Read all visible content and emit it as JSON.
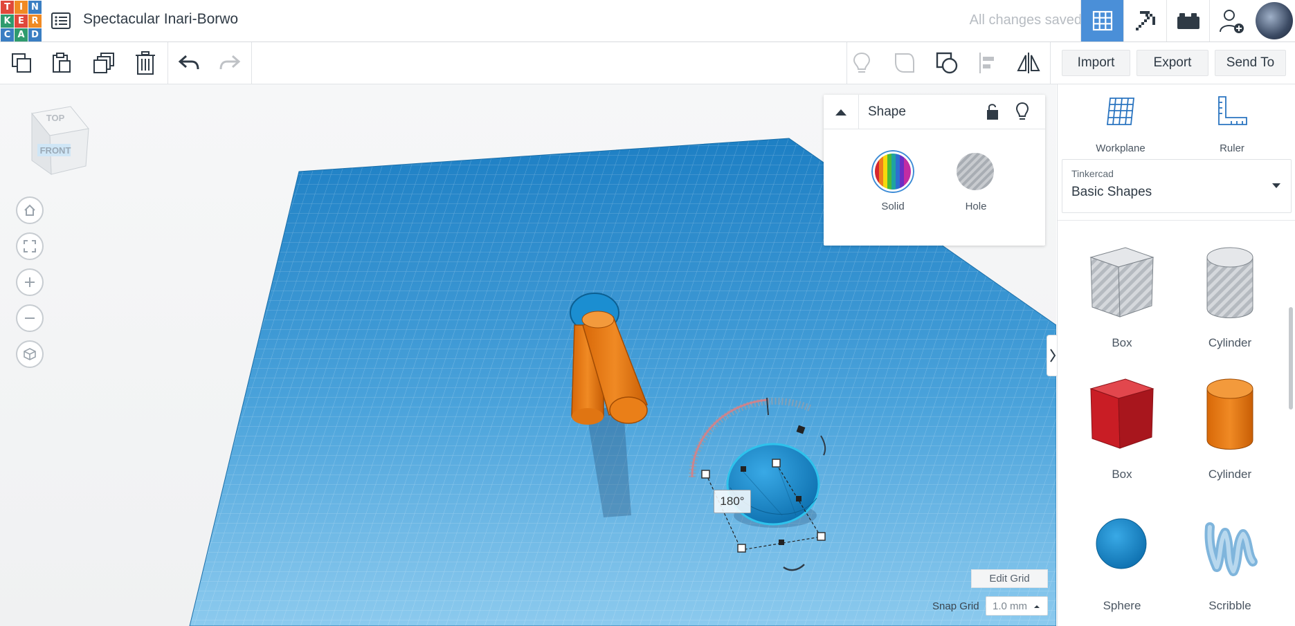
{
  "app": {
    "logo_letters": [
      "T",
      "I",
      "N",
      "K",
      "E",
      "R",
      "C",
      "A",
      "D"
    ],
    "logo_colors": [
      "#e0483b",
      "#f08a24",
      "#3a7ec2",
      "#2f9b6e",
      "#e0483b",
      "#f08a24",
      "#3a7ec2",
      "#2f9b6e",
      "#3a7ec2"
    ],
    "design_title": "Spectacular Inari-Borwo",
    "save_status": "All changes saved"
  },
  "topbar": {
    "buttons": [
      {
        "name": "3d-view",
        "icon": "grid-icon",
        "active": true
      },
      {
        "name": "codeblocks",
        "icon": "pickaxe-icon",
        "active": false
      },
      {
        "name": "bricks",
        "icon": "lego-brick-icon",
        "active": false
      },
      {
        "name": "add-user",
        "icon": "add-user-icon",
        "active": false
      }
    ]
  },
  "toolbar": {
    "copy": "copy-icon",
    "paste": "paste-icon",
    "duplicate": "duplicate-icon",
    "delete": "trash-icon",
    "undo": "undo-icon",
    "redo": "redo-icon",
    "notes": "lightbulb-icon",
    "group": "group-icon",
    "ungroup": "ungroup-icon",
    "align": "align-icon",
    "mirror": "mirror-icon",
    "import_label": "Import",
    "export_label": "Export",
    "sendto_label": "Send To"
  },
  "viewcube": {
    "top": "TOP",
    "front": "FRONT"
  },
  "inspector": {
    "title": "Shape",
    "solid_label": "Solid",
    "hole_label": "Hole"
  },
  "panel": {
    "workplane_label": "Workplane",
    "ruler_label": "Ruler",
    "library_source": "Tinkercad",
    "library_name": "Basic Shapes",
    "shapes": [
      {
        "label": "Box",
        "kind": "box-hole",
        "color": "#c4c8ce"
      },
      {
        "label": "Cylinder",
        "kind": "cylinder-hole",
        "color": "#c4c8ce"
      },
      {
        "label": "Box",
        "kind": "box",
        "color": "#d4202a"
      },
      {
        "label": "Cylinder",
        "kind": "cylinder",
        "color": "#ef7d1d"
      },
      {
        "label": "Sphere",
        "kind": "sphere",
        "color": "#1b8ed1"
      },
      {
        "label": "Scribble",
        "kind": "scribble",
        "color": "#8ec1e3"
      }
    ]
  },
  "workspace": {
    "rotation_readout": "180°",
    "edit_grid_label": "Edit Grid",
    "snap_grid_label": "Snap Grid",
    "snap_grid_value": "1.0 mm"
  }
}
